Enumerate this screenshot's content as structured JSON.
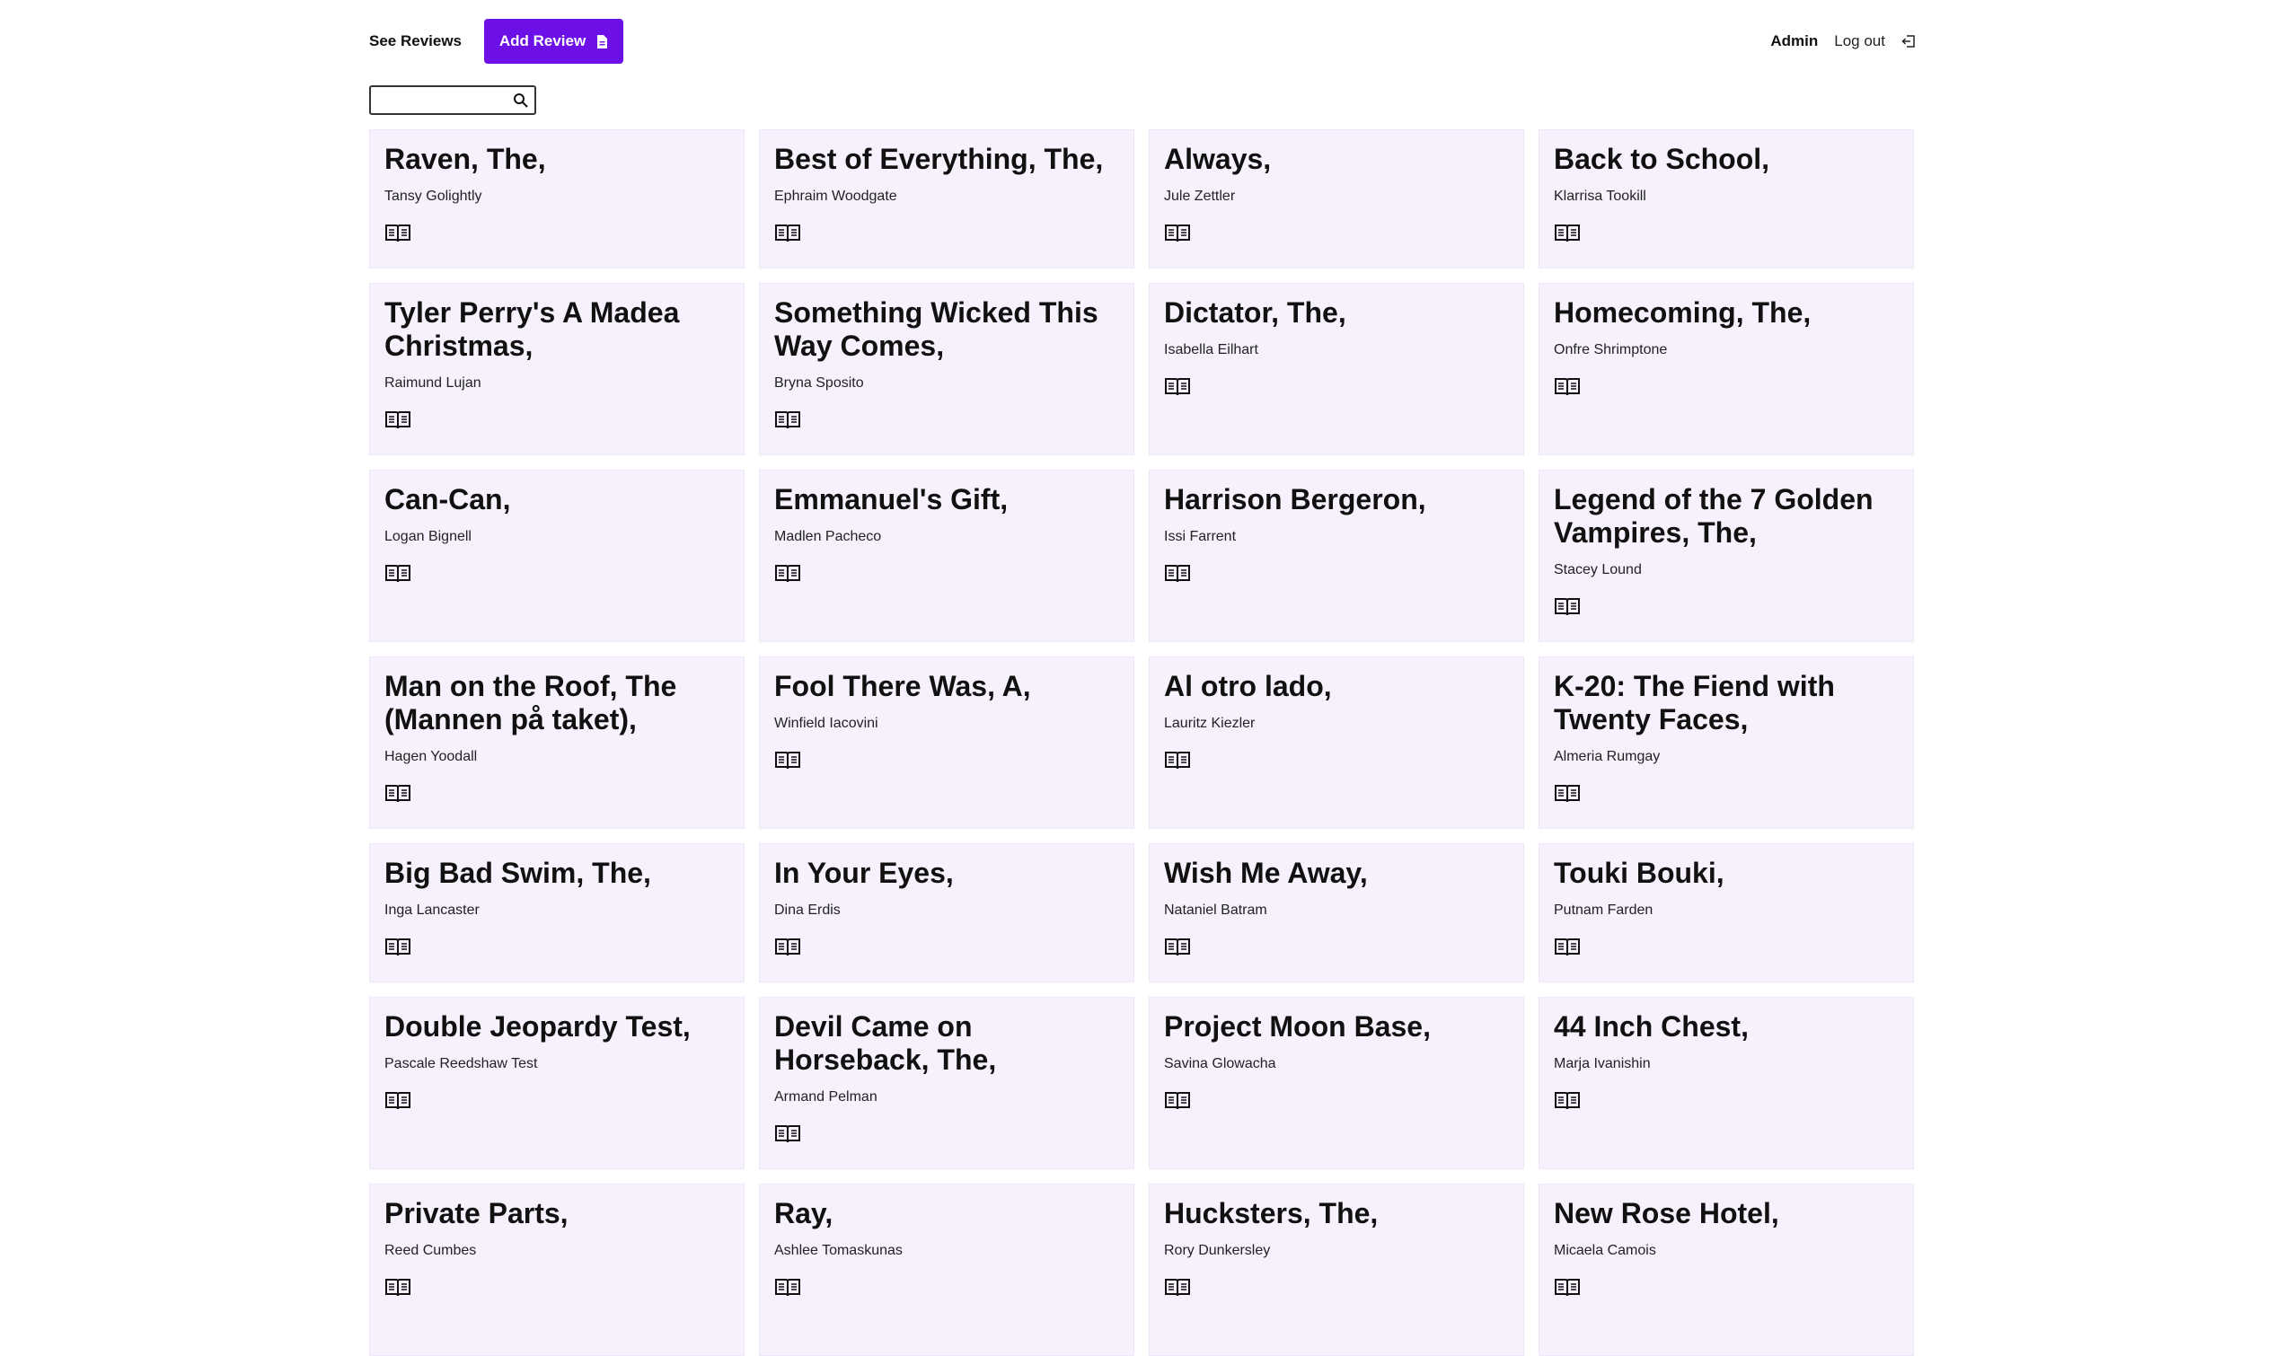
{
  "header": {
    "see_reviews": "See Reviews",
    "add_review": "Add Review",
    "admin": "Admin",
    "logout": "Log out"
  },
  "search": {
    "value": "",
    "placeholder": ""
  },
  "colors": {
    "accent": "#6d10e8",
    "card_bg": "#f6f1fd"
  },
  "reviews": [
    {
      "title": "Raven, The,",
      "author": "Tansy Golightly"
    },
    {
      "title": "Best of Everything, The,",
      "author": "Ephraim Woodgate"
    },
    {
      "title": "Always,",
      "author": "Jule Zettler"
    },
    {
      "title": "Back to School,",
      "author": "Klarrisa Tookill"
    },
    {
      "title": "Tyler Perry's A Madea Christmas,",
      "author": "Raimund Lujan"
    },
    {
      "title": "Something Wicked This Way Comes,",
      "author": "Bryna Sposito"
    },
    {
      "title": "Dictator, The,",
      "author": "Isabella Eilhart"
    },
    {
      "title": "Homecoming, The,",
      "author": "Onfre Shrimptone"
    },
    {
      "title": "Can-Can,",
      "author": "Logan Bignell"
    },
    {
      "title": "Emmanuel's Gift,",
      "author": "Madlen Pacheco"
    },
    {
      "title": "Harrison Bergeron,",
      "author": "Issi Farrent"
    },
    {
      "title": "Legend of the 7 Golden Vampires, The,",
      "author": "Stacey Lound"
    },
    {
      "title": "Man on the Roof, The (Mannen på taket),",
      "author": "Hagen Yoodall"
    },
    {
      "title": "Fool There Was, A,",
      "author": "Winfield Iacovini"
    },
    {
      "title": "Al otro lado,",
      "author": "Lauritz Kiezler"
    },
    {
      "title": "K-20: The Fiend with Twenty Faces,",
      "author": "Almeria Rumgay"
    },
    {
      "title": "Big Bad Swim, The,",
      "author": "Inga Lancaster"
    },
    {
      "title": "In Your Eyes,",
      "author": "Dina Erdis"
    },
    {
      "title": "Wish Me Away,",
      "author": "Nataniel Batram"
    },
    {
      "title": "Touki Bouki,",
      "author": "Putnam Farden"
    },
    {
      "title": "Double Jeopardy Test,",
      "author": "Pascale Reedshaw Test"
    },
    {
      "title": "Devil Came on Horseback, The,",
      "author": "Armand Pelman"
    },
    {
      "title": "Project Moon Base,",
      "author": "Savina Glowacha"
    },
    {
      "title": "44 Inch Chest,",
      "author": "Marja Ivanishin"
    },
    {
      "title": "Private Parts,",
      "author": "Reed Cumbes"
    },
    {
      "title": "Ray,",
      "author": "Ashlee Tomaskunas"
    },
    {
      "title": "Hucksters, The,",
      "author": "Rory Dunkersley"
    },
    {
      "title": "New Rose Hotel,",
      "author": "Micaela Camois"
    }
  ]
}
